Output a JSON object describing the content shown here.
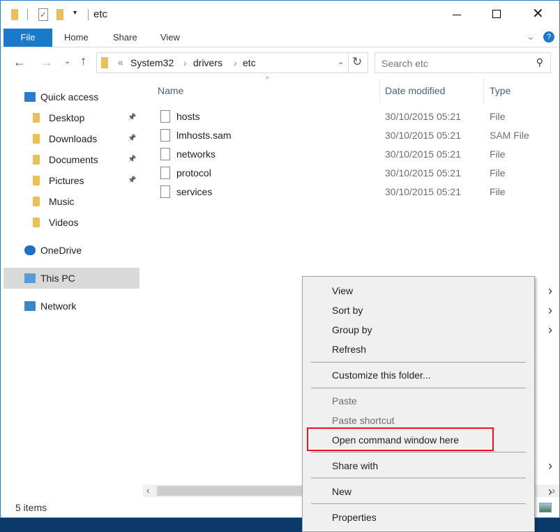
{
  "window": {
    "title": "etc",
    "tabs": [
      "File",
      "Home",
      "Share",
      "View"
    ]
  },
  "address": {
    "overflow": "«",
    "segments": [
      "System32",
      "drivers",
      "etc"
    ],
    "search_placeholder": "Search etc"
  },
  "nav": {
    "items": [
      {
        "label": "Quick access",
        "icon": "star-icon",
        "pinned": false
      },
      {
        "label": "Desktop",
        "icon": "folder-icon",
        "pinned": true
      },
      {
        "label": "Downloads",
        "icon": "folder-icon",
        "pinned": true
      },
      {
        "label": "Documents",
        "icon": "folder-icon",
        "pinned": true
      },
      {
        "label": "Pictures",
        "icon": "folder-icon",
        "pinned": true
      },
      {
        "label": "Music",
        "icon": "music-folder-icon",
        "pinned": false
      },
      {
        "label": "Videos",
        "icon": "video-folder-icon",
        "pinned": false
      },
      {
        "label": "OneDrive",
        "icon": "cloud-icon",
        "pinned": false
      },
      {
        "label": "This PC",
        "icon": "computer-icon",
        "pinned": false,
        "selected": true
      },
      {
        "label": "Network",
        "icon": "network-icon",
        "pinned": false
      }
    ]
  },
  "columns": {
    "name": "Name",
    "date": "Date modified",
    "type": "Type"
  },
  "files": [
    {
      "name": "hosts",
      "date": "30/10/2015 05:21",
      "type": "File"
    },
    {
      "name": "lmhosts.sam",
      "date": "30/10/2015 05:21",
      "type": "SAM File"
    },
    {
      "name": "networks",
      "date": "30/10/2015 05:21",
      "type": "File"
    },
    {
      "name": "protocol",
      "date": "30/10/2015 05:21",
      "type": "File"
    },
    {
      "name": "services",
      "date": "30/10/2015 05:21",
      "type": "File"
    }
  ],
  "status": "5 items",
  "context_menu": {
    "items": [
      "View",
      "Sort by",
      "Group by",
      "Refresh",
      "Customize this folder...",
      "Paste",
      "Paste shortcut",
      "Open command window here",
      "Share with",
      "New",
      "Properties"
    ],
    "highlight_color": "#e81123"
  }
}
